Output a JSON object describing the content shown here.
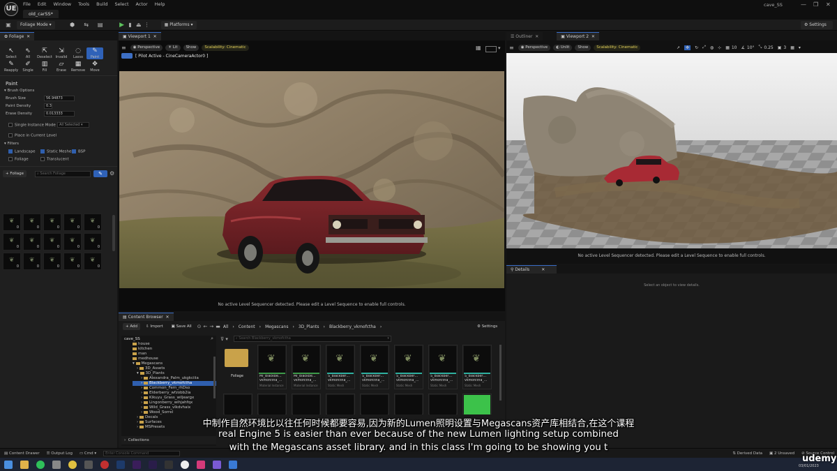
{
  "app": {
    "logo": "UE",
    "menus": [
      "File",
      "Edit",
      "Window",
      "Tools",
      "Build",
      "Select",
      "Actor",
      "Help"
    ],
    "level_tab": "old_carSS*",
    "project": "cave_SS",
    "window_buttons": [
      "—",
      "❐",
      "✕"
    ]
  },
  "toolbar": {
    "save_icon": "save-icon",
    "mode": "Foliage Mode",
    "platforms": "Platforms",
    "settings": "Settings"
  },
  "foliage_panel": {
    "tab": "Foliage",
    "tools_row1": [
      "Select",
      "All",
      "Deselect",
      "Invalid",
      "Lasso",
      "Paint"
    ],
    "tools_row2": [
      "Reapply",
      "Single",
      "Fill",
      "Erase",
      "Remove",
      "Move"
    ],
    "section": "Paint",
    "brush_options": "Brush Options",
    "brush_size_label": "Brush Size",
    "brush_size": "56.94873",
    "paint_density_label": "Paint Density",
    "paint_density": "0.3",
    "erase_density_label": "Erase Density",
    "erase_density": "0.013333",
    "single_instance_label": "Single Instance Mode",
    "single_instance_value": "All Selected",
    "place_current_level": "Place in Current Level",
    "filters": "Filters",
    "filter_landscape": "Landscape",
    "filter_static_meshes": "Static Meshes",
    "filter_bsp": "BSP",
    "filter_foliage": "Foliage",
    "filter_translucent": "Translucent",
    "add_foliage": "+ Foliage",
    "search_placeholder": "Search Foliage",
    "cell_count": "0"
  },
  "viewport1": {
    "tab": "Viewport 1",
    "perspective": "Perspective",
    "lit": "Lit",
    "show": "Show",
    "scalability": "Scalability: Cinematic",
    "pilot": "[ Pilot Active - CineCameraActor0 ]",
    "sequencer_msg": "No active Level Sequencer detected. Please edit a Level Sequence to enable full controls."
  },
  "viewport2": {
    "outliner_tab": "Outliner",
    "tab": "Viewport 2",
    "perspective": "Perspective",
    "unlit": "Unlit",
    "show": "Show",
    "scalability": "Scalability: Cinematic",
    "grid_value": "10",
    "rot_value": "10°",
    "scale_value": "0.25",
    "cam_value": "3",
    "sequencer_msg": "No active Level Sequencer detected. Please edit a Level Sequence to enable full controls."
  },
  "details": {
    "tab": "Details",
    "empty_msg": "Select an object to view details."
  },
  "content_browser": {
    "tab": "Content Browser",
    "add": "+ Add",
    "import": "Import",
    "save_all": "Save All",
    "crumbs": [
      "All",
      "Content",
      "Megascans",
      "3D_Plants",
      "Blackberry_vkmofctha"
    ],
    "settings": "Settings",
    "root": "cave_SS",
    "search_placeholder": "Search Blackberry_vkmofctha",
    "tree": [
      "house",
      "kitchen",
      "man",
      "medhouse",
      "Megascans",
      "3D_Assets",
      "3D_Plants",
      "Alexandra_Palm_ukgkciiia",
      "Blackberry_vkmofctha",
      "Common_Fern_rhDso",
      "Elderberry_wfzobb2ia",
      "Kikuyu_Grass_wiljeargx",
      "Lingonberry_wihjahfqx",
      "Wild_Grass_vlkdvhaix",
      "Wood_Sorrel",
      "Decals",
      "Surfaces",
      "MSPresets"
    ],
    "collections": "Collections",
    "folder_label": "Foliage",
    "assets": [
      {
        "name": "MI_Blackbe…",
        "sub": "vkmofctha_…",
        "type": "Material Instance",
        "color": "#3d9a4a"
      },
      {
        "name": "MI_Blackbe…",
        "sub": "vkmofctha_…",
        "type": "Material Instance",
        "color": "#3d9a4a"
      },
      {
        "name": "S_Blackber…",
        "sub": "vkmofctha_…",
        "type": "Static Mesh",
        "color": "#2fb0a0"
      },
      {
        "name": "S_Blackber…",
        "sub": "vkmofctha_…",
        "type": "Static Mesh",
        "color": "#2fb0a0"
      },
      {
        "name": "S_Blackber…",
        "sub": "vkmofctha_…",
        "type": "Static Mesh",
        "color": "#2fb0a0"
      },
      {
        "name": "S_Blackber…",
        "sub": "vkmofctha_…",
        "type": "Static Mesh",
        "color": "#2fb0a0"
      },
      {
        "name": "S_Blackber…",
        "sub": "vkmofctha_…",
        "type": "Static Mesh",
        "color": "#2fb0a0"
      }
    ]
  },
  "statusbar": {
    "content_drawer": "Content Drawer",
    "output_log": "Output Log",
    "cmd": "Cmd",
    "console_placeholder": "Enter Console Command",
    "derived_data": "Derived Data",
    "unsaved": "2 Unsaved",
    "source_control": "Source Control"
  },
  "taskbar": {
    "date": "03/01/2023",
    "brand": "udemy"
  },
  "subtitles": {
    "zh": "中制作自然环境比以往任何时候都要容易,因为新的Lumen照明设置与Megascans资产库相结合,在这个课程",
    "en1": "real Engine 5 is easier than ever because of the new Lumen lighting setup combined",
    "en2": "with the Megascans asset library. and in this class I'm going to be showing you t"
  }
}
